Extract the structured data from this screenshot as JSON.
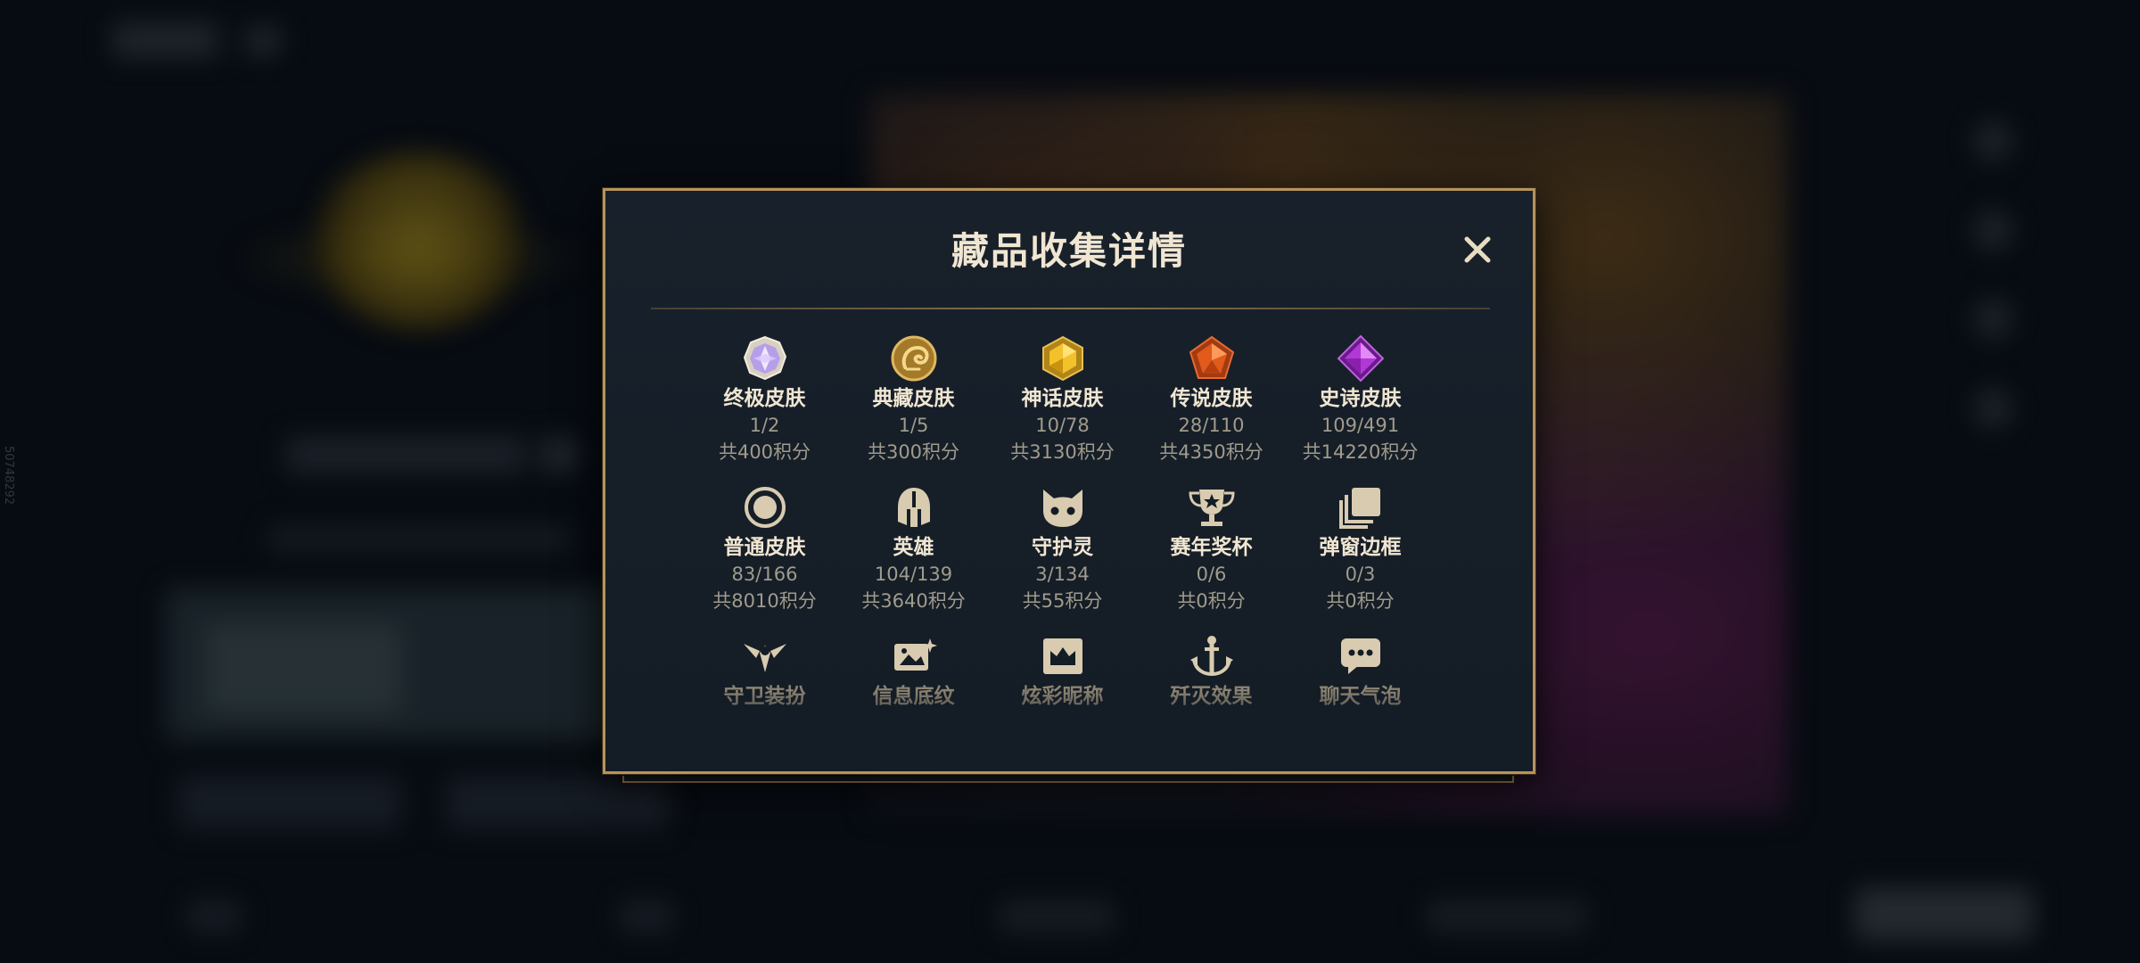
{
  "modal": {
    "title": "藏品收集详情",
    "close_icon": "close-icon",
    "categories": [
      {
        "label": "终极皮肤",
        "count": "1/2",
        "points": "共400积分",
        "icon": "ultimate-skin-icon"
      },
      {
        "label": "典藏皮肤",
        "count": "1/5",
        "points": "共300积分",
        "icon": "prestige-skin-icon"
      },
      {
        "label": "神话皮肤",
        "count": "10/78",
        "points": "共3130积分",
        "icon": "mythic-skin-icon"
      },
      {
        "label": "传说皮肤",
        "count": "28/110",
        "points": "共4350积分",
        "icon": "legendary-skin-icon"
      },
      {
        "label": "史诗皮肤",
        "count": "109/491",
        "points": "共14220积分",
        "icon": "epic-skin-icon"
      },
      {
        "label": "普通皮肤",
        "count": "83/166",
        "points": "共8010积分",
        "icon": "standard-skin-icon"
      },
      {
        "label": "英雄",
        "count": "104/139",
        "points": "共3640积分",
        "icon": "champion-helmet-icon"
      },
      {
        "label": "守护灵",
        "count": "3/134",
        "points": "共55积分",
        "icon": "little-legend-icon"
      },
      {
        "label": "赛年奖杯",
        "count": "0/6",
        "points": "共0积分",
        "icon": "trophy-icon"
      },
      {
        "label": "弹窗边框",
        "count": "0/3",
        "points": "共0积分",
        "icon": "frame-icon"
      },
      {
        "label": "守卫装扮",
        "icon": "ward-skin-icon"
      },
      {
        "label": "信息底纹",
        "icon": "banner-icon"
      },
      {
        "label": "炫彩昵称",
        "icon": "nickname-crown-icon"
      },
      {
        "label": "歼灭效果",
        "icon": "ace-effect-icon"
      },
      {
        "label": "聊天气泡",
        "icon": "chat-bubble-icon"
      }
    ]
  },
  "background": {
    "side_id": "50748292"
  },
  "colors": {
    "gold_border": "#b8935a",
    "title_text": "#f0e6d2",
    "sub_text": "#a09b8c"
  }
}
